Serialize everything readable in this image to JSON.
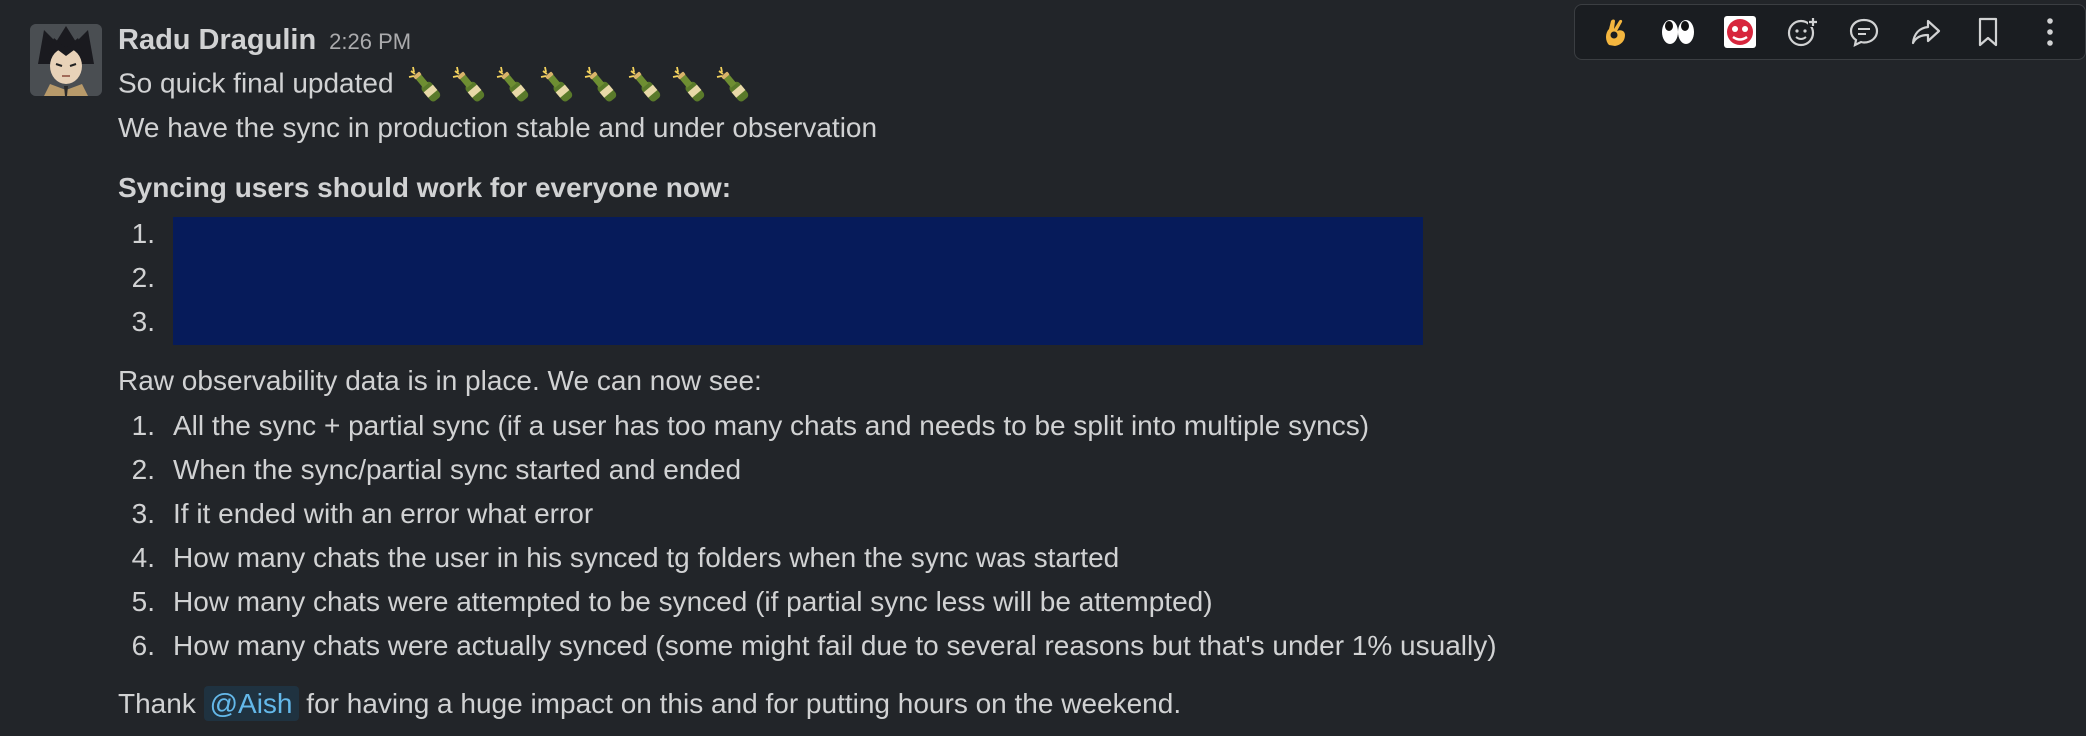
{
  "message": {
    "author": "Radu Dragulin",
    "timestamp": "2:26 PM",
    "line1": "So quick final updated",
    "line1_emoji": "bottle-with-popping-cork",
    "line1_emoji_count": 8,
    "line2": "We have the sync in production stable and under observation",
    "syncing_heading": "Syncing users should work for everyone now:",
    "redacted_items": [
      {
        "num": "1."
      },
      {
        "num": "2."
      },
      {
        "num": "3."
      }
    ],
    "observability_intro": "Raw observability data is in place. We can now see:",
    "observability_items": [
      {
        "num": "1.",
        "text": "All the sync + partial sync (if a user has too many chats and needs to be split into multiple syncs)"
      },
      {
        "num": "2.",
        "text": "When the sync/partial sync started and ended"
      },
      {
        "num": "3.",
        "text": "If it ended with an error what error"
      },
      {
        "num": "4.",
        "text": "How many chats the user in his synced tg folders when the sync was started"
      },
      {
        "num": "5.",
        "text": "How many chats were attempted to be synced (if partial sync less will be attempted)"
      },
      {
        "num": "6.",
        "text": "How many chats were actually synced (some might fail due to several reasons but that's under 1% usually)"
      }
    ],
    "thanks_before": "Thank",
    "thanks_mention": "@Aish",
    "thanks_after": "for having a huge impact on this and for putting hours on the weekend."
  },
  "toolbar": {
    "items": [
      {
        "icon": "ok-hand-emoji-icon"
      },
      {
        "icon": "eyes-emoji-icon"
      },
      {
        "icon": "custom-emoji-icon"
      },
      {
        "icon": "add-reaction-icon"
      },
      {
        "icon": "reply-in-thread-icon"
      },
      {
        "icon": "forward-icon"
      },
      {
        "icon": "bookmark-icon"
      },
      {
        "icon": "more-actions-icon"
      }
    ]
  },
  "colors": {
    "background": "#222529",
    "text": "#d1d2d3",
    "timestamp": "#ababad",
    "redaction": "#061b5a",
    "mention_bg": "#1f3240",
    "mention_text": "#64b8e9"
  }
}
